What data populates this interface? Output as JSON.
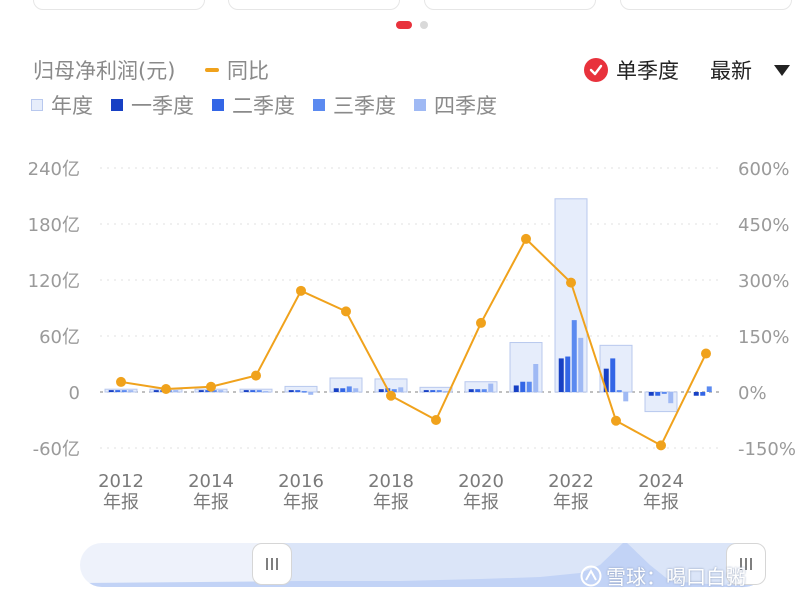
{
  "header": {
    "title": "归母净利润(元)",
    "yoy_label": "同比",
    "mode_label": "单季度",
    "sort_label": "最新"
  },
  "legend": [
    {
      "label": "年度",
      "color": "#e6edfb"
    },
    {
      "label": "一季度",
      "color": "#1740c4"
    },
    {
      "label": "二季度",
      "color": "#3366e6"
    },
    {
      "label": "三季度",
      "color": "#5b8af0"
    },
    {
      "label": "四季度",
      "color": "#9fb9f4"
    }
  ],
  "chart_data": {
    "type": "bar",
    "x": [
      2012,
      2013,
      2014,
      2015,
      2016,
      2017,
      2018,
      2019,
      2020,
      2021,
      2022,
      2023,
      2024,
      2025
    ],
    "x_tick_labels": [
      {
        "year": 2012,
        "line1": "2012",
        "line2": "年报"
      },
      {
        "year": 2014,
        "line1": "2014",
        "line2": "年报"
      },
      {
        "year": 2016,
        "line1": "2016",
        "line2": "年报"
      },
      {
        "year": 2018,
        "line1": "2018",
        "line2": "年报"
      },
      {
        "year": 2020,
        "line1": "2020",
        "line2": "年报"
      },
      {
        "year": 2022,
        "line1": "2022",
        "line2": "年报"
      },
      {
        "year": 2024,
        "line1": "2024",
        "line2": "年报"
      }
    ],
    "left_axis": {
      "unit": "亿",
      "ticks": [
        "240亿",
        "180亿",
        "120亿",
        "60亿",
        "0",
        "-60亿"
      ],
      "ylim": [
        -60,
        240
      ]
    },
    "right_axis": {
      "ticks": [
        "600%",
        "450%",
        "300%",
        "150%",
        "0%",
        "-150%"
      ],
      "ylim": [
        -150,
        600
      ]
    },
    "series": [
      {
        "name": "年度",
        "values": [
          3,
          3,
          3,
          3,
          6,
          15,
          14,
          5,
          11,
          53,
          207,
          50,
          -21,
          null
        ]
      },
      {
        "name": "一季度",
        "values": [
          2,
          2,
          2,
          2,
          2,
          4,
          3,
          2,
          3,
          7,
          36,
          25,
          -4,
          -4
        ]
      },
      {
        "name": "二季度",
        "values": [
          2,
          2,
          2,
          2,
          2,
          4,
          4,
          2,
          3,
          11,
          38,
          36,
          -4,
          -4
        ]
      },
      {
        "name": "三季度",
        "values": [
          2,
          2,
          2,
          2,
          1,
          6,
          3,
          2,
          3,
          11,
          77,
          2,
          -2,
          6
        ]
      },
      {
        "name": "四季度",
        "values": [
          2,
          2,
          2,
          1,
          -3,
          4,
          5,
          1,
          9,
          30,
          58,
          -10,
          -12,
          null
        ]
      },
      {
        "name": "同比",
        "axis": "right",
        "values": [
          27,
          8,
          14,
          44,
          271,
          216,
          -10,
          -75,
          185,
          410,
          293,
          -77,
          -143,
          103
        ]
      }
    ],
    "grid": true,
    "legend_position": "top-left"
  },
  "watermark": {
    "text": "雪球：喝口白粥"
  }
}
